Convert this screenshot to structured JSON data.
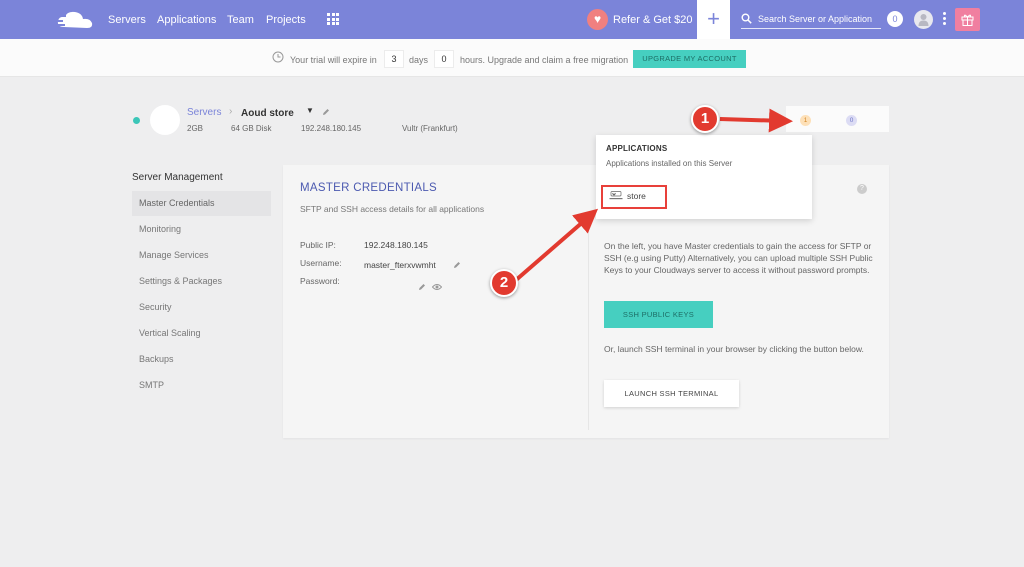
{
  "nav": {
    "links": [
      "Servers",
      "Applications",
      "Team",
      "Projects"
    ],
    "refer_label": "Refer & Get $20",
    "plus_label": "+",
    "search_placeholder": "Search Server or Application",
    "notifications_count": "0"
  },
  "trial": {
    "prefix": "Your trial will expire in",
    "days_value": "3",
    "days_label": "days",
    "hours_value": "0",
    "suffix": "hours. Upgrade and claim a free migration",
    "upgrade_button": "UPGRADE MY ACCOUNT"
  },
  "server": {
    "breadcrumb_parent": "Servers",
    "breadcrumb_sep": "›",
    "breadcrumb_current": "Aoud store",
    "ram": "2GB",
    "disk": "64 GB Disk",
    "ip": "192.248.180.145",
    "provider": "Vultr (Frankfurt)",
    "app_count": "1",
    "other_count": "0"
  },
  "sidebar": {
    "title": "Server Management",
    "items": [
      {
        "label": "Master Credentials"
      },
      {
        "label": "Monitoring"
      },
      {
        "label": "Manage Services"
      },
      {
        "label": "Settings & Packages"
      },
      {
        "label": "Security"
      },
      {
        "label": "Vertical Scaling"
      },
      {
        "label": "Backups"
      },
      {
        "label": "SMTP"
      }
    ]
  },
  "card": {
    "title": "MASTER CREDENTIALS",
    "subtitle": "SFTP and SSH access details for all applications",
    "public_ip_label": "Public IP:",
    "public_ip_value": "192.248.180.145",
    "username_label": "Username:",
    "username_value": "master_fterxvwmht",
    "password_label": "Password:",
    "info_text": "On the left, you have Master credentials to gain the access for SFTP or SSH (e.g using Putty) Alternatively, you can upload multiple SSH Public Keys to your Cloudways server to access it without password prompts.",
    "ssh_keys_button": "SSH PUBLIC KEYS",
    "launch_text": "Or, launch SSH terminal in your browser by clicking the button below.",
    "launch_button": "LAUNCH SSH TERMINAL",
    "help": "?"
  },
  "dropdown": {
    "title": "APPLICATIONS",
    "subtitle": "Applications installed on this Server",
    "app_name": "store",
    "app_logo_text": "WOOCOMMERCE"
  },
  "annotations": {
    "marker_1": "1",
    "marker_2": "2",
    "color": "#e23a2f"
  },
  "colors": {
    "nav_bg": "#7b84d9",
    "accent_teal": "#46cfc0",
    "title_blue": "#4c5ab0"
  }
}
